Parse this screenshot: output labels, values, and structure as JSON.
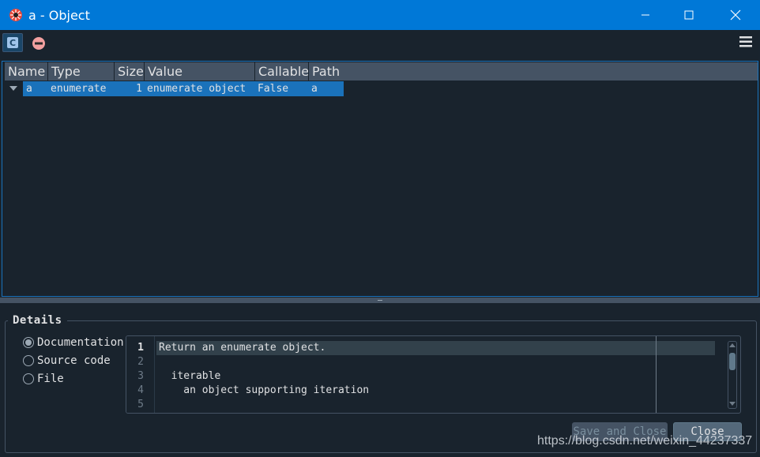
{
  "window": {
    "title": "a - Object",
    "app_icon": "spyder-logo-icon",
    "controls": [
      "minimize-icon",
      "maximize-icon",
      "close-icon"
    ]
  },
  "toolbar": {
    "class_button_label": "C",
    "class_button_icon": "class-icon",
    "remove_icon": "minus-circle-icon",
    "menu_icon": "hamburger-menu-icon"
  },
  "tree": {
    "columns": [
      "Name",
      "Type",
      "Size",
      "Value",
      "Callable",
      "Path"
    ],
    "rows": [
      {
        "name": "a",
        "type": "enumerate",
        "size": "1",
        "value": "enumerate object",
        "callable": "False",
        "path": "a"
      }
    ]
  },
  "details": {
    "title": "Details",
    "options": [
      {
        "label": "Documentation",
        "selected": true
      },
      {
        "label": "Source code",
        "selected": false
      },
      {
        "label": "File",
        "selected": false
      }
    ],
    "editor": {
      "line_numbers": [
        "1",
        "2",
        "3",
        "4",
        "5"
      ],
      "lines": [
        "Return an enumerate object.",
        "",
        "  iterable",
        "    an object supporting iteration",
        ""
      ]
    },
    "buttons": {
      "save_and_close": "Save and Close",
      "close": "Close"
    }
  },
  "watermark": "https://blog.csdn.net/weixin_44237337",
  "colors": {
    "titlebar": "#0078d7",
    "background": "#19232d",
    "selection": "#1a72bb",
    "header": "#455364",
    "text": "#e0e1e3"
  }
}
